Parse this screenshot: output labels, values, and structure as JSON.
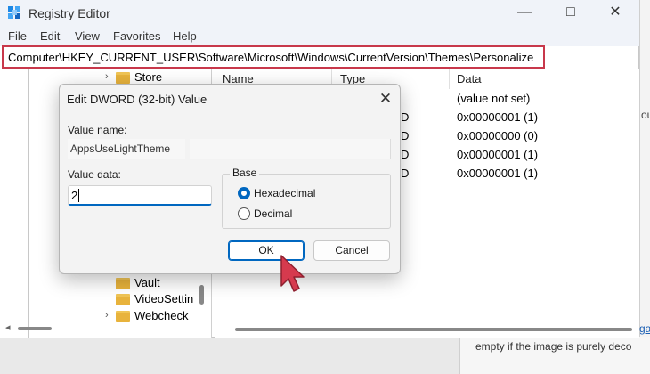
{
  "window": {
    "title": "Registry Editor"
  },
  "menu": [
    "File",
    "Edit",
    "View",
    "Favorites",
    "Help"
  ],
  "address": "Computer\\HKEY_CURRENT_USER\\Software\\Microsoft\\Windows\\CurrentVersion\\Themes\\Personalize",
  "tree": {
    "items": [
      "Store",
      "Vault",
      "VideoSettin",
      "Webcheck"
    ]
  },
  "list": {
    "columns": [
      "Name",
      "Type",
      "Data"
    ],
    "type_fragments": [
      "D",
      "D",
      "D",
      "D"
    ],
    "data": [
      "(value not set)",
      "0x00000001 (1)",
      "0x00000000 (0)",
      "0x00000001 (1)",
      "0x00000001 (1)"
    ]
  },
  "dialog": {
    "title": "Edit DWORD (32-bit) Value",
    "value_name_label": "Value name:",
    "value_name": "AppsUseLightTheme",
    "value_data_label": "Value data:",
    "value_data": "2",
    "base_label": "Base",
    "base_options": [
      "Hexadecimal",
      "Decimal"
    ],
    "base_selected": "Hexadecimal",
    "ok_label": "OK",
    "cancel_label": "Cancel"
  },
  "background": {
    "right_text": "ou",
    "right_link": "ga",
    "bottom_text": "empty if the image is purely deco"
  },
  "colors": {
    "accent": "#0067c0",
    "address_highlight": "#c8384b",
    "cursor": "#d63a4e",
    "folder": "#e8b33c"
  },
  "icons": [
    "registry-editor-icon",
    "minimize-icon",
    "maximize-icon",
    "close-icon",
    "folder-icon",
    "chevron-right-icon",
    "pointer-cursor-icon"
  ]
}
